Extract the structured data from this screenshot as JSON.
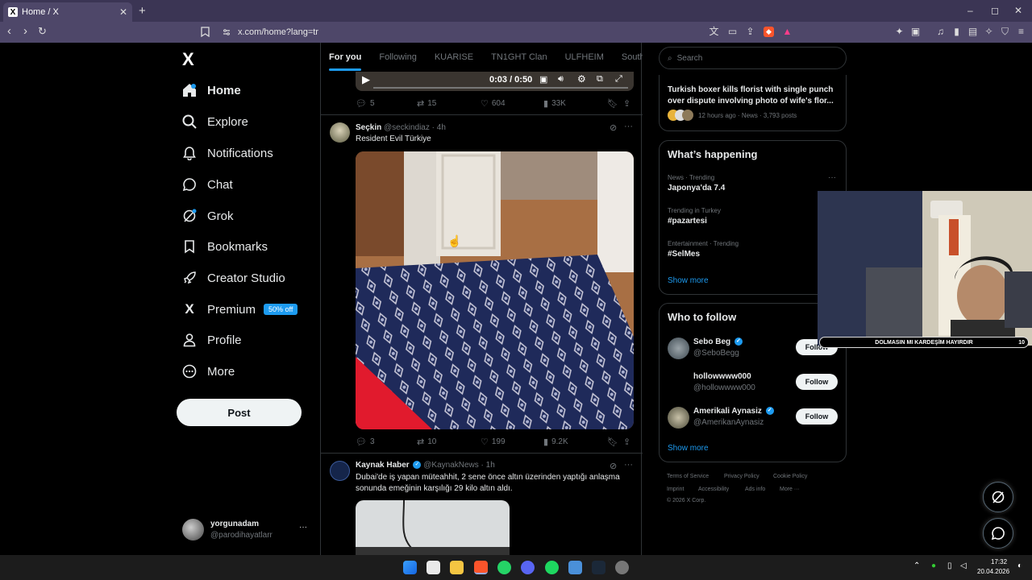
{
  "browser": {
    "tab_title": "Home / X",
    "new_tab": "+",
    "url": "x.com/home?lang=tr",
    "window_controls": [
      "–",
      "◻",
      "✕"
    ]
  },
  "nav": {
    "logo": "X",
    "items": [
      {
        "label": "Home",
        "icon": "home-icon"
      },
      {
        "label": "Explore",
        "icon": "search-icon"
      },
      {
        "label": "Notifications",
        "icon": "bell-icon"
      },
      {
        "label": "Chat",
        "icon": "chat-icon"
      },
      {
        "label": "Grok",
        "icon": "grok-icon"
      },
      {
        "label": "Bookmarks",
        "icon": "bookmark-icon"
      },
      {
        "label": "Creator Studio",
        "icon": "rocket-icon"
      },
      {
        "label": "Premium",
        "icon": "x-icon"
      },
      {
        "label": "Profile",
        "icon": "person-icon"
      },
      {
        "label": "More",
        "icon": "more-circle-icon"
      }
    ],
    "premium_badge": "50% off",
    "post_label": "Post",
    "user": {
      "name": "yorgunadam",
      "handle": "@parodihayatlarr",
      "more": "···"
    }
  },
  "timeline": {
    "tabs": [
      "For you",
      "Following",
      "KUARISE",
      "TN1GHT Clan",
      "ULFHEIM",
      "South Side"
    ],
    "video_time": "0:03 / 0:50",
    "tweet0_actions": {
      "replies": "5",
      "reposts": "15",
      "likes": "604",
      "views": "33K"
    },
    "tweet1": {
      "name": "Seçkin",
      "meta": "@seckindiaz · 4h",
      "text": "Resident Evil Türkiye",
      "actions": {
        "replies": "3",
        "reposts": "10",
        "likes": "199",
        "views": "9.2K"
      }
    },
    "tweet2": {
      "name": "Kaynak Haber",
      "meta": "@KaynakNews · 1h",
      "text": "Dubai'de iş yapan müteahhit, 2 sene önce altın üzerinden yaptığı anlaşma sonunda emeğinin karşılığı 29 kilo altın aldı."
    }
  },
  "right": {
    "search_placeholder": "Search",
    "news": {
      "headline": "Turkish boxer kills florist with single punch over dispute involving photo of wife's flor...",
      "meta": "12 hours ago · News · 3,793 posts"
    },
    "happening": {
      "title": "What’s happening",
      "trends": [
        {
          "context": "News · Trending",
          "name": "Japonya'da 7.4"
        },
        {
          "context": "Trending in Turkey",
          "name": "#pazartesi"
        },
        {
          "context": "Entertainment · Trending",
          "name": "#SelMes"
        }
      ],
      "more": "···",
      "show_more": "Show more"
    },
    "who_to_follow": {
      "title": "Who to follow",
      "users": [
        {
          "name": "Sebo Beg",
          "handle": "@SeboBegg",
          "button": "Follow"
        },
        {
          "name": "hollowwww000",
          "handle": "@hollowwww000",
          "button": "Follow"
        },
        {
          "name": "Amerikali Aynasiz",
          "handle": "@AmerikanAynasiz",
          "button": "Follow"
        }
      ],
      "show_more": "Show more"
    },
    "footer": {
      "links1": [
        "Terms of Service",
        "Privacy Policy",
        "Cookie Policy"
      ],
      "links2": [
        "Imprint",
        "Accessibility",
        "Ads info",
        "More ···"
      ],
      "copyright": "© 2026 X Corp."
    }
  },
  "overlay": {
    "caption": "DOLMASIN MI KARDEŞİM HAYIRDIR",
    "caption_count": "10"
  },
  "taskbar": {
    "time": "17:32",
    "date": "20.04.2026"
  }
}
